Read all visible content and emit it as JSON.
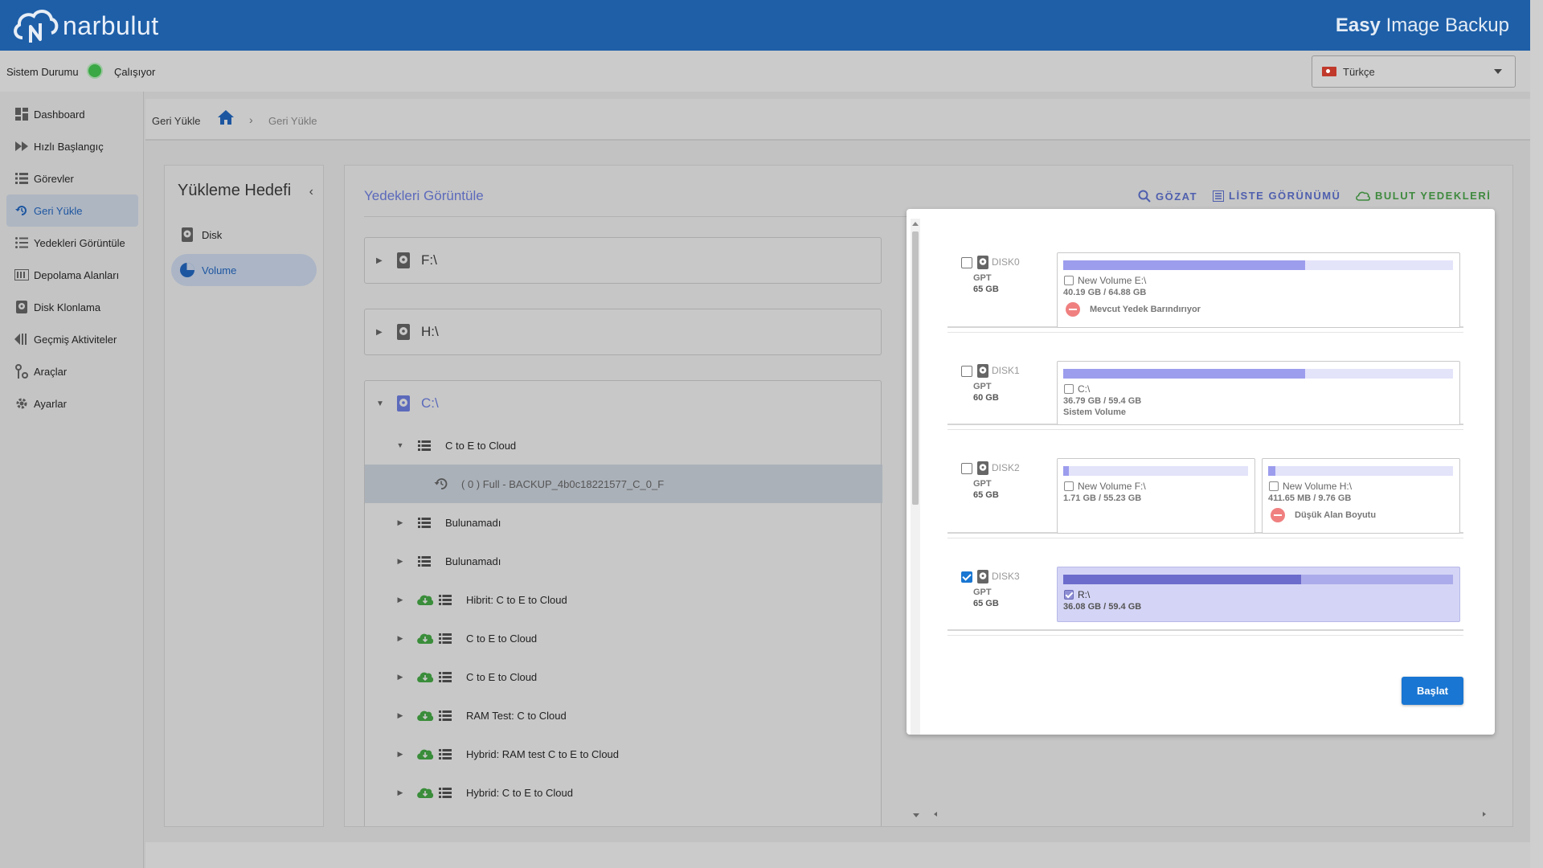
{
  "app": {
    "logo_text": "narbulut",
    "title_bold": "Easy",
    "title_rest": " Image Backup"
  },
  "status": {
    "label": "Sistem Durumu",
    "value": "Çalışıyor",
    "color": "#3aa845"
  },
  "language": {
    "selected": "Türkçe"
  },
  "sidebar": {
    "items": [
      {
        "label": "Dashboard",
        "icon": "dashboard-icon"
      },
      {
        "label": "Hızlı Başlangıç",
        "icon": "fast-forward-icon"
      },
      {
        "label": "Görevler",
        "icon": "list-icon"
      },
      {
        "label": "Geri Yükle",
        "icon": "restore-icon",
        "active": true
      },
      {
        "label": "Yedekleri Görüntüle",
        "icon": "list-icon"
      },
      {
        "label": "Depolama Alanları",
        "icon": "storage-icon"
      },
      {
        "label": "Disk Klonlama",
        "icon": "disk-icon"
      },
      {
        "label": "Geçmiş Aktiviteler",
        "icon": "history-icon"
      },
      {
        "label": "Araçlar",
        "icon": "tools-icon"
      },
      {
        "label": "Ayarlar",
        "icon": "gear-icon"
      }
    ]
  },
  "breadcrumb": {
    "root": "Geri Yükle",
    "current": "Geri Yükle"
  },
  "left_panel": {
    "title": "Yükleme Hedefi",
    "items": [
      {
        "label": "Disk",
        "icon": "disk-icon"
      },
      {
        "label": "Volume",
        "icon": "pie-icon",
        "active": true
      }
    ]
  },
  "main": {
    "title": "Yedekleri Görüntüle",
    "actions": {
      "browse": "GÖZAT",
      "list_view": "LİSTE GÖRÜNÜMÜ",
      "cloud_backups": "BULUT YEDEKLERİ"
    },
    "volumes": [
      "F:\\",
      "H:\\",
      "C:\\"
    ],
    "tree": [
      {
        "label": "C to E to Cloud",
        "level": 1,
        "expanded": true,
        "cloud": false
      },
      {
        "label": "( 0 ) Full - BACKUP_4b0c18221577_C_0_F",
        "level": 2,
        "selected": true
      },
      {
        "label": "Bulunamadı",
        "level": 1,
        "cloud": false
      },
      {
        "label": "Bulunamadı",
        "level": 1,
        "cloud": false
      },
      {
        "label": "Hibrit: C to E to Cloud",
        "level": 1,
        "cloud": true
      },
      {
        "label": "C to E to Cloud",
        "level": 1,
        "cloud": true
      },
      {
        "label": "C to E to Cloud",
        "level": 1,
        "cloud": true
      },
      {
        "label": "RAM Test: C to Cloud",
        "level": 1,
        "cloud": true
      },
      {
        "label": "Hybrid: RAM test C to E to Cloud",
        "level": 1,
        "cloud": true
      },
      {
        "label": "Hybrid: C to E to Cloud",
        "level": 1,
        "cloud": true
      }
    ]
  },
  "dialog": {
    "disks": [
      {
        "name": "DISK0",
        "type": "GPT",
        "size": "65 GB",
        "checked": false,
        "partitions": [
          {
            "label": "New Volume E:\\",
            "usage": "40.19 GB / 64.88 GB",
            "fill": 0.62,
            "note": "Mevcut Yedek Barındırıyor",
            "note_type": "warn",
            "checked": false
          }
        ]
      },
      {
        "name": "DISK1",
        "type": "GPT",
        "size": "60 GB",
        "checked": false,
        "partitions": [
          {
            "label": "C:\\",
            "usage": "36.79 GB / 59.4 GB",
            "fill": 0.62,
            "note": "Sistem Volume",
            "note_type": "plain",
            "checked": false
          }
        ]
      },
      {
        "name": "DISK2",
        "type": "GPT",
        "size": "65 GB",
        "checked": false,
        "partitions": [
          {
            "label": "New Volume F:\\",
            "usage": "1.71 GB / 55.23 GB",
            "fill": 0.03,
            "checked": false
          },
          {
            "label": "New Volume H:\\",
            "usage": "411.65 MB / 9.76 GB",
            "fill": 0.04,
            "note": "Düşük Alan Boyutu",
            "note_type": "warn",
            "checked": false
          }
        ]
      },
      {
        "name": "DISK3",
        "type": "GPT",
        "size": "65 GB",
        "checked": true,
        "partitions": [
          {
            "label": "R:\\",
            "usage": "36.08 GB / 59.4 GB",
            "fill": 0.61,
            "checked": true,
            "selected": true
          }
        ]
      }
    ],
    "start_button": "Başlat"
  }
}
